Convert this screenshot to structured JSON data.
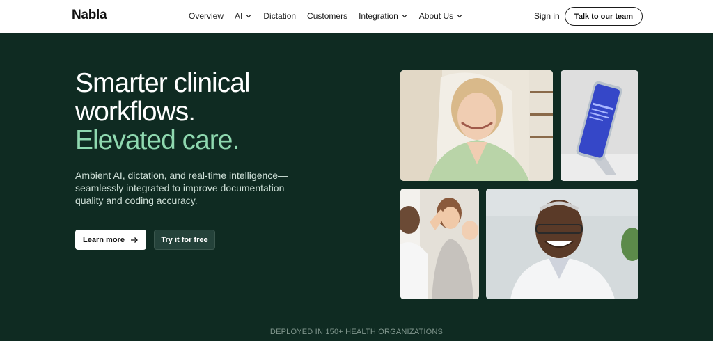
{
  "nav": {
    "logo": "Nabla",
    "items": [
      "Overview",
      "AI",
      "Dictation",
      "Customers",
      "Integration",
      "About Us"
    ],
    "sign_in": "Sign in",
    "cta": "Talk to our team"
  },
  "hero": {
    "headline_line1": "Smarter clinical",
    "headline_line2": "workflows.",
    "headline_accent": "Elevated care.",
    "subtext": "Ambient AI, dictation, and real-time intelligence—seamlessly integrated to improve documentation quality and coding accuracy.",
    "learn_more": "Learn more",
    "try_free": "Try it for free",
    "deployed": "DEPLOYED IN 150+ HEALTH ORGANIZATIONS"
  },
  "colors": {
    "hero_bg": "#0f2b22",
    "accent": "#8fd9b0"
  }
}
